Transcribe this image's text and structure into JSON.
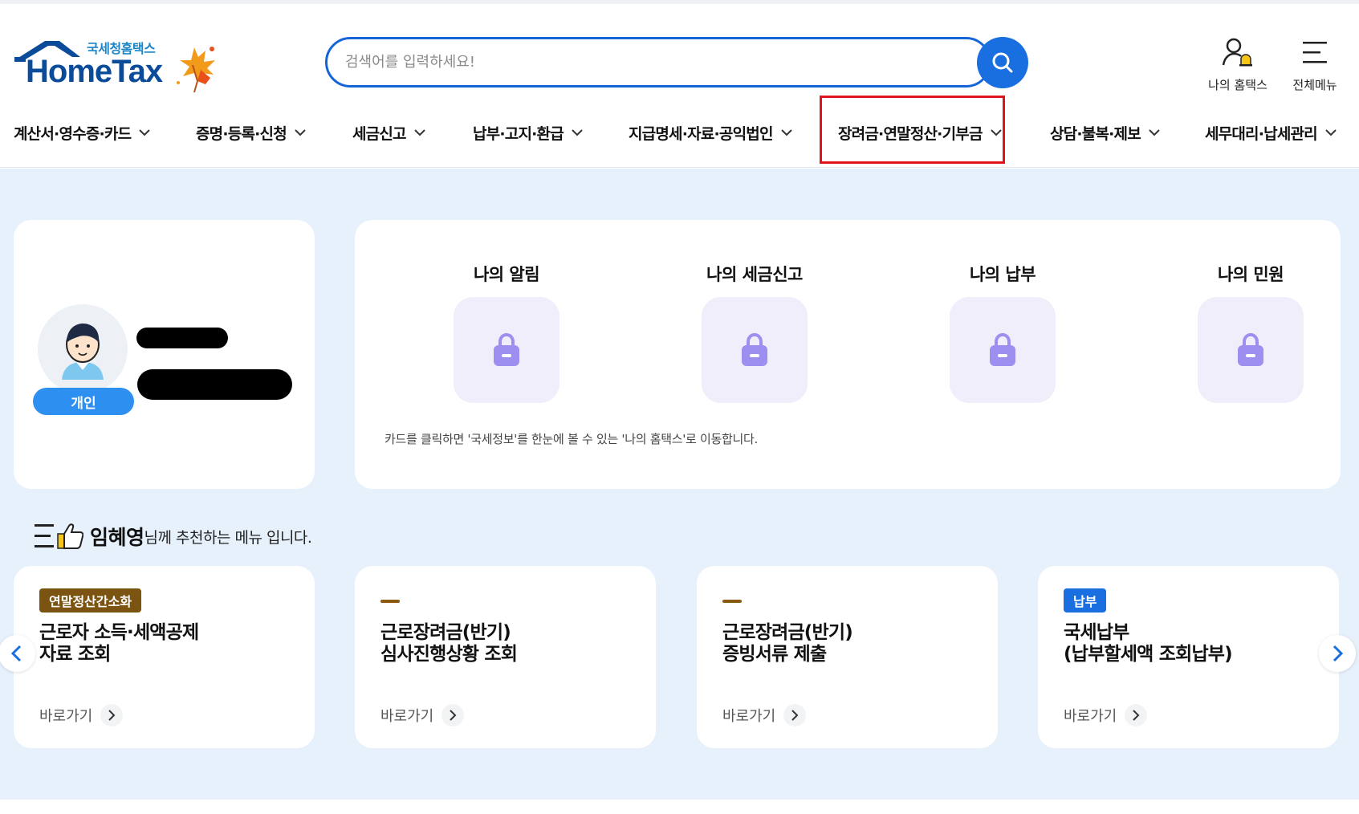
{
  "logo": {
    "small_text": "국세청홈택스",
    "main_text": "HomeTax"
  },
  "search": {
    "placeholder": "검색어를 입력하세요!"
  },
  "utility": {
    "my_hometax": "나의 홈택스",
    "all_menu": "전체메뉴"
  },
  "gnb": [
    {
      "label": "계산서·영수증·카드"
    },
    {
      "label": "증명·등록·신청"
    },
    {
      "label": "세금신고"
    },
    {
      "label": "납부·고지·환급"
    },
    {
      "label": "지급명세·자료·공익법인"
    },
    {
      "label": "장려금·연말정산·기부금"
    },
    {
      "label": "상담·불복·제보"
    },
    {
      "label": "세무대리·납세관리"
    }
  ],
  "profile": {
    "badge": "개인"
  },
  "quick": {
    "items": [
      {
        "label": "나의 알림"
      },
      {
        "label": "나의 세금신고"
      },
      {
        "label": "나의 납부"
      },
      {
        "label": "나의 민원"
      }
    ],
    "note": "카드를 클릭하면 '국세정보'를 한눈에 볼 수 있는 '나의 홈택스'로 이동합니다."
  },
  "recommend": {
    "name": "임혜영",
    "suffix": "님께 추천하는 메뉴 입니다.",
    "cards": [
      {
        "badge": "연말정산간소화",
        "badge_color": "#7a5410",
        "title": "근로자 소득·세액공제\n자료 조회",
        "go": "바로가기"
      },
      {
        "badge": "",
        "badge_color": "#8a5a12",
        "title": "근로장려금(반기)\n심사진행상황 조회",
        "go": "바로가기"
      },
      {
        "badge": "",
        "badge_color": "#8a5a12",
        "title": "근로장려금(반기)\n증빙서류 제출",
        "go": "바로가기"
      },
      {
        "badge": "납부",
        "badge_color": "#1a6fe0",
        "title": "국세납부\n(납부할세액 조회납부)",
        "go": "바로가기"
      }
    ]
  },
  "colors": {
    "primary": "#1a6fe0",
    "highlight": "#e0141b",
    "background": "#e6f1fb",
    "lock": "#9d8ff0"
  }
}
